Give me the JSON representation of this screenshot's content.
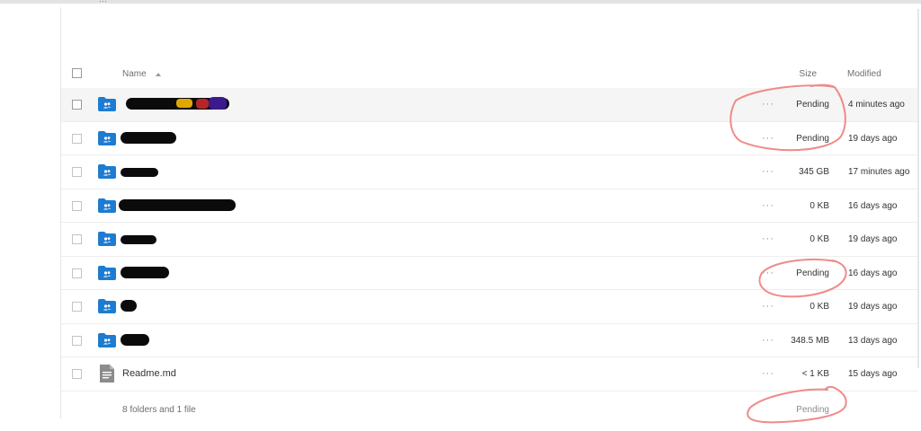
{
  "top_fragment": "...",
  "header": {
    "name": "Name",
    "size": "Size",
    "modified": "Modified"
  },
  "rows": [
    {
      "type": "folder",
      "size": "Pending",
      "modified": "4 minutes ago"
    },
    {
      "type": "folder",
      "size": "Pending",
      "modified": "19 days ago"
    },
    {
      "type": "folder",
      "size": "345 GB",
      "modified": "17 minutes ago"
    },
    {
      "type": "folder",
      "size": "0 KB",
      "modified": "16 days ago"
    },
    {
      "type": "folder",
      "size": "0 KB",
      "modified": "19 days ago"
    },
    {
      "type": "folder",
      "size": "Pending",
      "modified": "16 days ago"
    },
    {
      "type": "folder",
      "size": "0 KB",
      "modified": "19 days ago"
    },
    {
      "type": "folder",
      "size": "348.5 MB",
      "modified": "13 days ago"
    },
    {
      "type": "file",
      "name": "Readme.md",
      "size": "< 1 KB",
      "modified": "15 days ago"
    }
  ],
  "footer": {
    "summary": "8 folders and 1 file",
    "size": "Pending"
  },
  "icons": {
    "folder": "shared-folder-icon",
    "file": "document-icon",
    "more": "more-actions-icon",
    "sort": "sort-ascending-icon"
  },
  "colors": {
    "folder_blue": "#1d7cd1",
    "annotation_red": "#f08a8a",
    "row_highlight": "#f5f5f5"
  }
}
